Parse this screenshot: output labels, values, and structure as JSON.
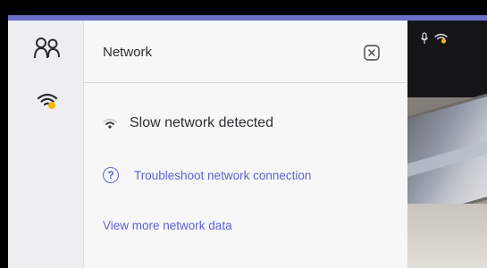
{
  "colors": {
    "accent": "#6b6fca",
    "link": "#5f5fcf",
    "warning": "#f2b705"
  },
  "rail": {
    "people_icon": "people-icon",
    "network_icon": "wifi-warning-icon"
  },
  "network_panel": {
    "title": "Network",
    "close_icon": "close-icon",
    "status": {
      "icon": "wifi-weak-icon",
      "text": "Slow network detected"
    },
    "troubleshoot": {
      "icon": "help-circle-icon",
      "label": "Troubleshoot network connection"
    },
    "more_data_link": "View more network data"
  },
  "video": {
    "mic_icon": "microphone-icon",
    "wifi_icon": "wifi-warning-icon"
  }
}
